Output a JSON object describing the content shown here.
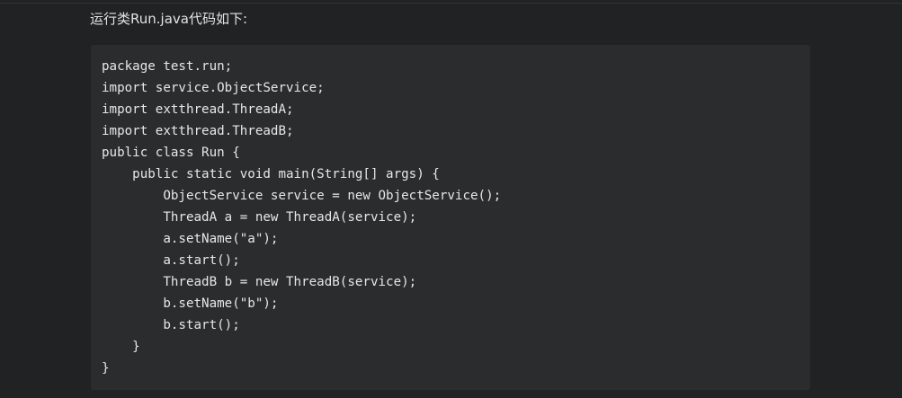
{
  "article": {
    "intro_text": "运行类Run.java代码如下:",
    "code_lines": [
      "package test.run;",
      "import service.ObjectService;",
      "import extthread.ThreadA;",
      "import extthread.ThreadB;",
      "public class Run {",
      "    public static void main(String[] args) {",
      "        ObjectService service = new ObjectService();",
      "        ThreadA a = new ThreadA(service);",
      "        a.setName(\"a\");",
      "        a.start();",
      "        ThreadB b = new ThreadB(service);",
      "        b.setName(\"b\");",
      "        b.start();",
      "    }",
      "}"
    ]
  },
  "colors": {
    "page_background": "#212223",
    "code_background": "#2b2c2e",
    "text": "#e6e7e8"
  }
}
